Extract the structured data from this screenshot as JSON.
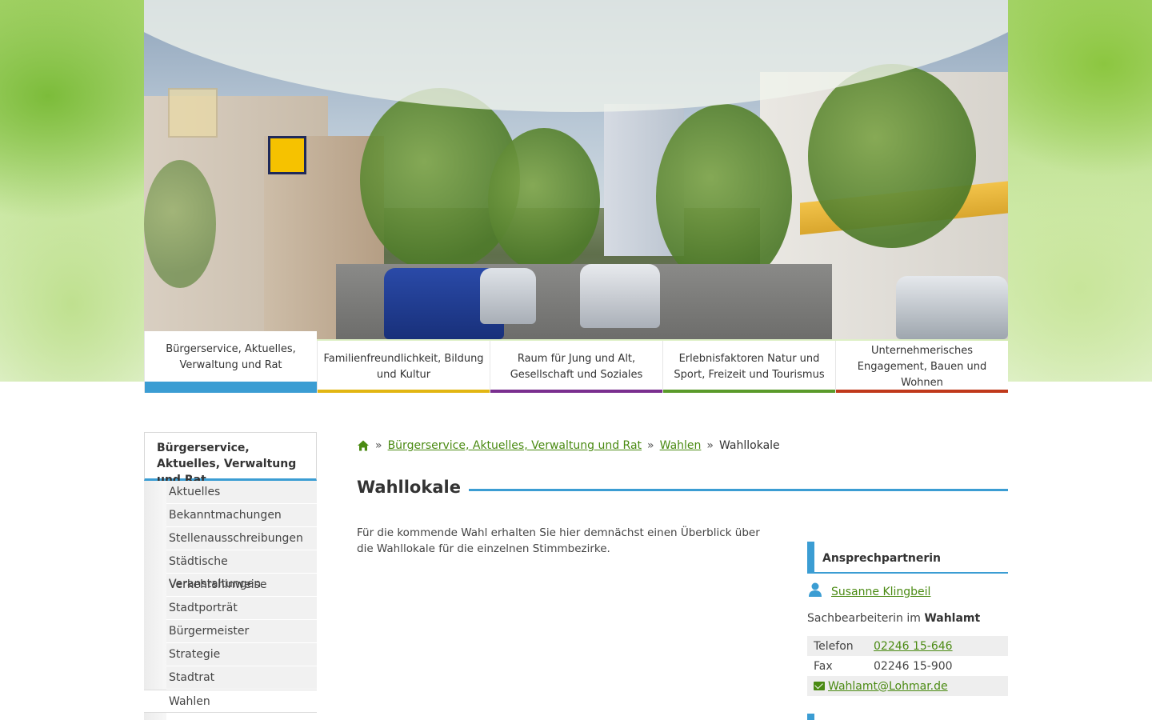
{
  "colors": {
    "accent_blue": "#3b9dd3",
    "link_green": "#4a8a12",
    "tab_bars": [
      "#3b9dd3",
      "#e2b613",
      "#7a2f8f",
      "#5a9a2a",
      "#c0391b"
    ]
  },
  "tabs": [
    {
      "label": "Bürgerservice, Aktuelles, Verwaltung und Rat",
      "active": true
    },
    {
      "label": "Familienfreundlichkeit, Bildung und Kultur",
      "active": false
    },
    {
      "label": "Raum für Jung und Alt, Gesellschaft und Soziales",
      "active": false
    },
    {
      "label": "Erlebnisfaktoren Natur und Sport, Freizeit und Tourismus",
      "active": false
    },
    {
      "label": "Unternehmerisches Engagement, Bauen und Wohnen",
      "active": false
    }
  ],
  "sidebar": {
    "heading": "Bürgerservice, Aktuelles, Verwaltung und Rat",
    "items": [
      {
        "label": "Aktuelles"
      },
      {
        "label": "Bekanntmachungen"
      },
      {
        "label": "Stellenausschreibungen"
      },
      {
        "label": "Städtische Veranstaltungen"
      },
      {
        "label": "Verkehrshinweise"
      },
      {
        "label": "Stadtporträt"
      },
      {
        "label": "Bürgermeister"
      },
      {
        "label": "Strategie"
      },
      {
        "label": "Stadtrat"
      },
      {
        "label": "Wahlen",
        "current": true
      }
    ]
  },
  "breadcrumb": {
    "home_icon": "home-icon",
    "separator": "»",
    "items": [
      "Bürgerservice, Aktuelles, Verwaltung und Rat",
      "Wahlen"
    ],
    "current": "Wahllokale"
  },
  "page": {
    "title": "Wahllokale",
    "intro": "Für die kommende Wahl erhalten Sie hier demnächst einen Überblick über die Wahllokale für die einzelnen Stimmbezirke."
  },
  "contact": {
    "heading": "Ansprechpartnerin",
    "person_icon": "person-icon",
    "name": "Susanne Klingbeil",
    "role_prefix": "Sachbearbeiterin im",
    "role_department": "Wahlamt",
    "phone_label": "Telefon",
    "phone": "02246 15-646",
    "fax_label": "Fax",
    "fax": "02246 15-900",
    "mail_icon": "envelope-icon",
    "email": "Wahlamt@Lohmar.de"
  }
}
